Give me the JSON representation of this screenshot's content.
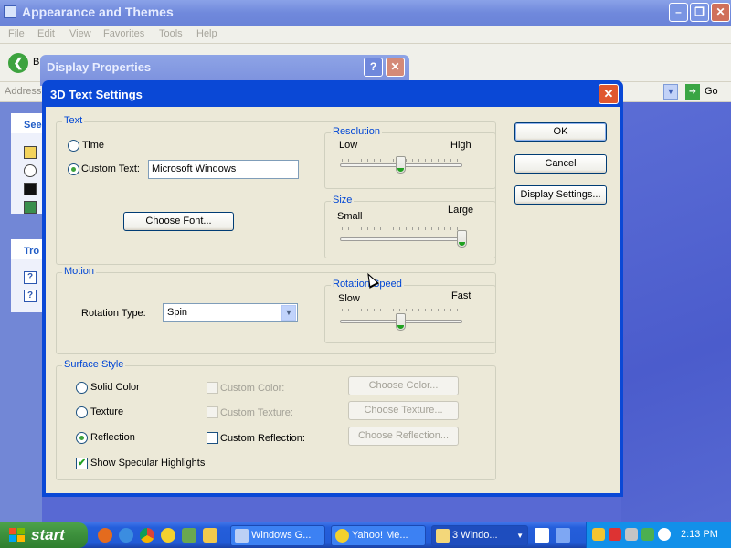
{
  "background_window": {
    "title": "Appearance and Themes",
    "menu": [
      "File",
      "Edit",
      "View",
      "Favorites",
      "Tools",
      "Help"
    ],
    "toolbar": {
      "back_label": "B"
    },
    "address": {
      "label": "Address",
      "go_label": "Go"
    },
    "sidebar": {
      "see_also_label": "See",
      "troubleshooters_label": "Tro"
    }
  },
  "display_properties": {
    "title": "Display Properties",
    "help_label": "?",
    "close_label": "✕"
  },
  "dialog": {
    "title": "3D Text Settings",
    "close_label": "✕",
    "text_group": {
      "label": "Text",
      "time_label": "Time",
      "custom_text_label": "Custom Text:",
      "custom_text_value": "Microsoft Windows",
      "selected": "custom_text",
      "choose_font_label": "Choose Font..."
    },
    "resolution": {
      "label": "Resolution",
      "low_label": "Low",
      "high_label": "High",
      "level": 0.5
    },
    "size": {
      "label": "Size",
      "small_label": "Small",
      "large_label": "Large",
      "level": 1.0
    },
    "motion_group": {
      "label": "Motion",
      "rotation_type_label": "Rotation Type:",
      "rotation_type_value": "Spin"
    },
    "rotation_speed": {
      "label": "Rotation Speed",
      "slow_label": "Slow",
      "fast_label": "Fast",
      "level": 0.5
    },
    "surface_group": {
      "label": "Surface Style",
      "solid_color_label": "Solid Color",
      "texture_label": "Texture",
      "reflection_label": "Reflection",
      "selected": "reflection",
      "custom_color_label": "Custom Color:",
      "custom_texture_label": "Custom Texture:",
      "custom_reflection_label": "Custom Reflection:",
      "choose_color_label": "Choose Color...",
      "choose_texture_label": "Choose Texture...",
      "choose_reflection_label": "Choose Reflection...",
      "specular_label": "Show Specular Highlights",
      "specular_checked": true
    },
    "buttons": {
      "ok": "OK",
      "cancel": "Cancel",
      "display_settings": "Display Settings..."
    }
  },
  "taskbar": {
    "start_label": "start",
    "tasks": [
      {
        "label": "Windows G...",
        "icon": "network-icon"
      },
      {
        "label": "Yahoo! Me...",
        "icon": "yahoo-messenger-icon"
      },
      {
        "label": "3 Windo...",
        "icon": "folder-icon"
      }
    ],
    "clock": "2:13 PM"
  },
  "colors": {
    "dialog_title": "#0a48d6",
    "group_label": "#0046d5",
    "taskbar": "#245edb",
    "start": "#3c8f3c"
  }
}
